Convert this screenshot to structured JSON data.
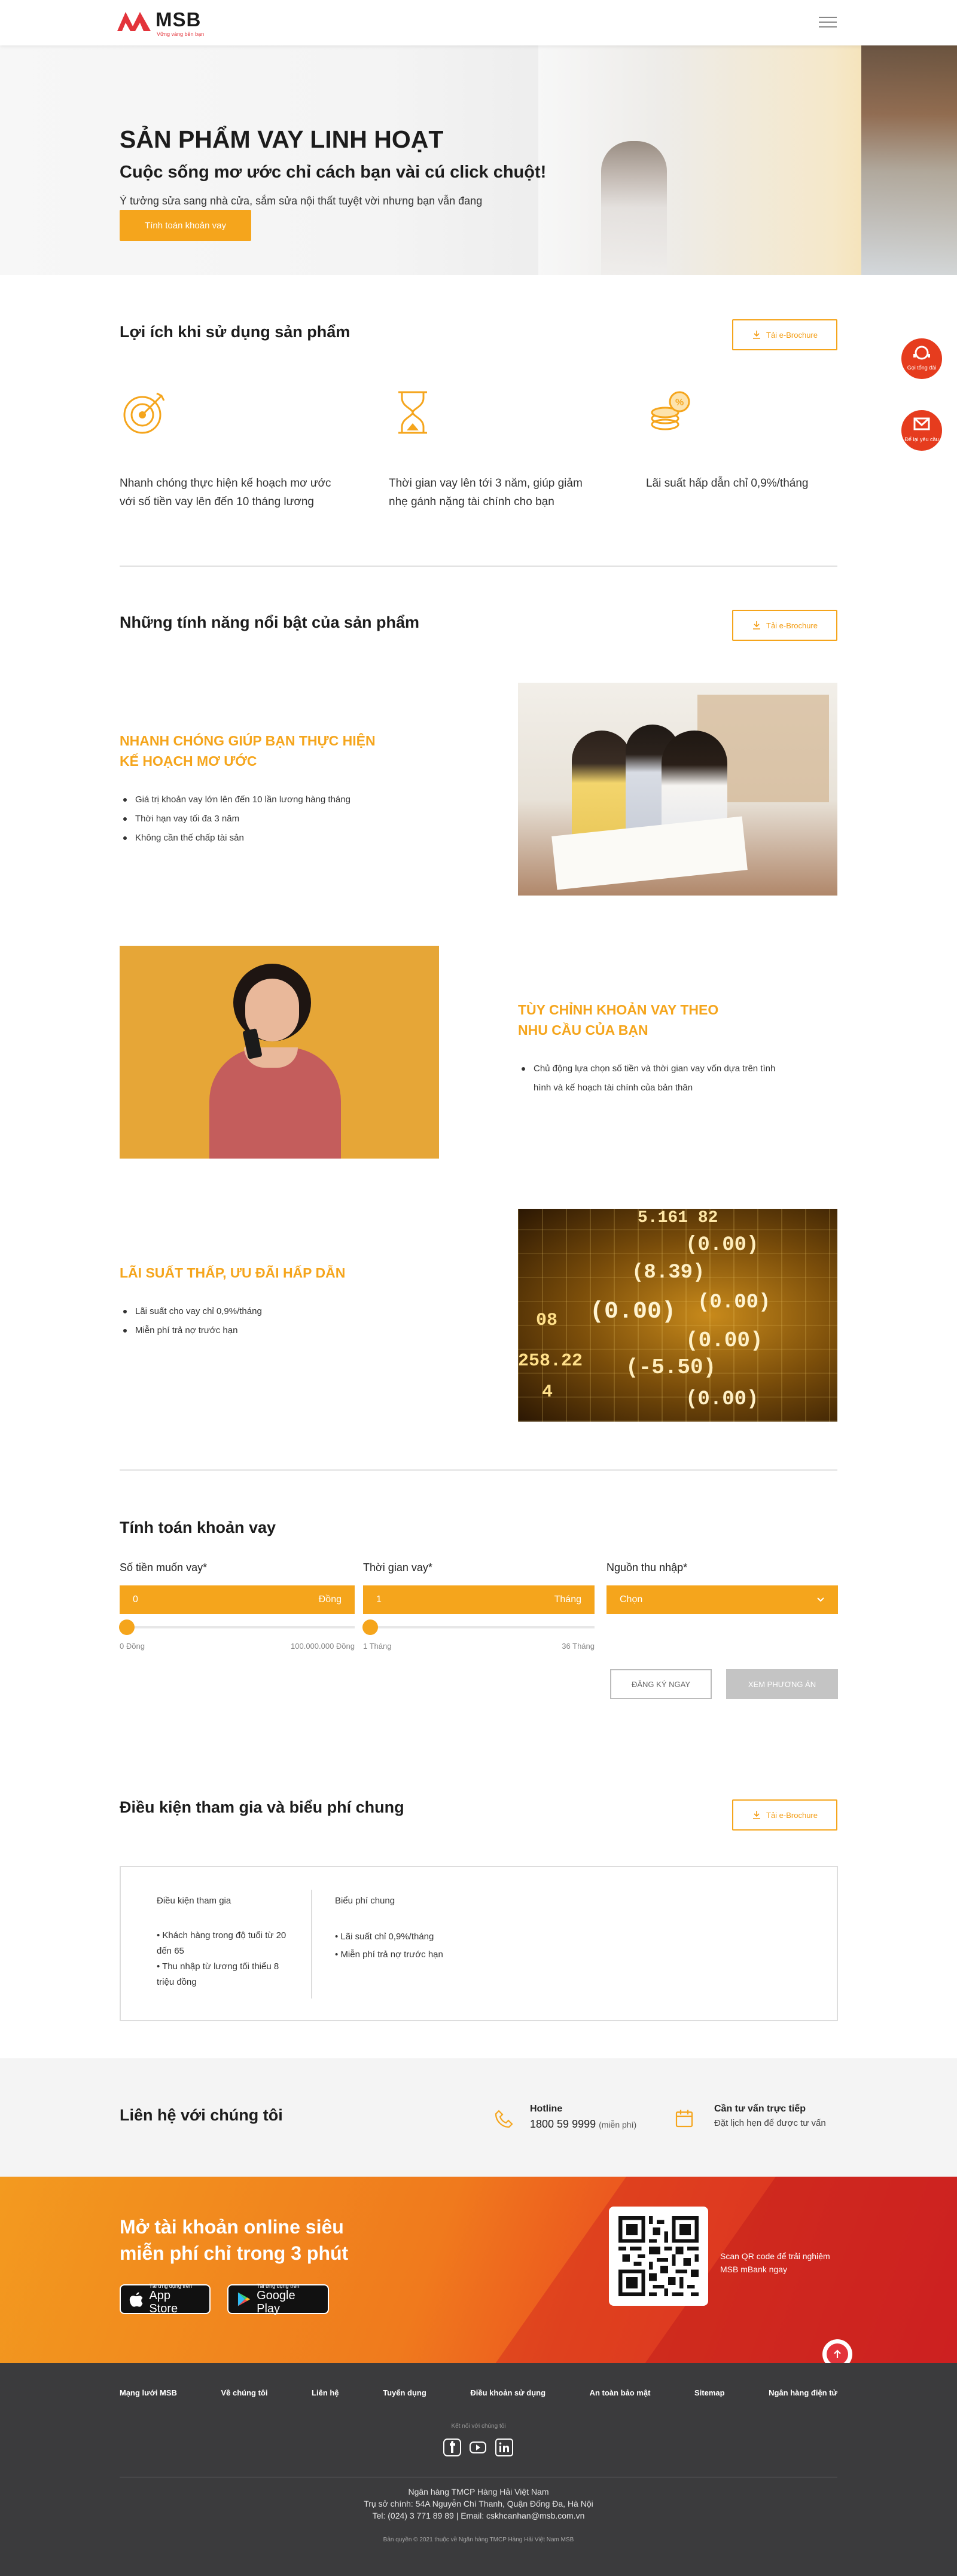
{
  "header": {
    "brand": "MSB",
    "tagline": "Vững vàng bên bạn"
  },
  "hero": {
    "title": "SẢN PHẨM VAY LINH HOẠT",
    "subtitle": "Cuộc sống mơ ước chỉ cách bạn vài cú click chuột!",
    "desc": "Ý tưởng sửa sang nhà cửa, sắm sửa nội thất tuyệt vời nhưng bạn vẫn đang đau đầu tìm vốn?",
    "cta": "Tính toán khoản vay"
  },
  "benefits": {
    "title": "Lợi ích khi sử dụng sản phẩm",
    "brochure": "Tải e-Brochure",
    "items": [
      {
        "icon": "target-icon",
        "text": "Nhanh chóng thực hiện kế hoạch mơ ước với số tiền vay lên đến 10 tháng lương"
      },
      {
        "icon": "hourglass-icon",
        "text": "Thời gian vay lên tới 3 năm, giúp giảm nhẹ gánh nặng tài chính cho bạn"
      },
      {
        "icon": "coins-percent-icon",
        "text": "Lãi suất hấp dẫn chỉ 0,9%/tháng"
      }
    ]
  },
  "features": {
    "title": "Những tính năng nổi bật của sản phẩm",
    "brochure": "Tải e-Brochure",
    "items": [
      {
        "heading1": "NHANH CHÓNG GIÚP BẠN THỰC HIỆN",
        "heading2": "KẾ HOẠCH MƠ ƯỚC",
        "bullets": [
          "Giá trị khoản vay lớn lên đến 10 lần lương hàng tháng",
          "Thời hạn vay tối đa 3 năm",
          "Không cần thế chấp tài sản"
        ]
      },
      {
        "heading1": "TÙY CHỈNH KHOẢN VAY THEO",
        "heading2": "NHU CẦU CỦA BẠN",
        "bullets": [
          "Chủ động lựa chọn số tiền và thời gian vay vốn dựa trên tình hình và kế hoạch tài chính của bản thân"
        ]
      },
      {
        "heading1": "LÃI SUẤT THẤP, ƯU ĐÃI HẤP DẪN",
        "bullets": [
          "Lãi suất cho vay chỉ 0,9%/tháng",
          "Miễn phí trả nợ trước hạn"
        ]
      }
    ],
    "numbers": [
      "5.161 82",
      "(0.00)",
      "(8.39)",
      "(0.00)",
      "08",
      "(0.00)",
      "(-5.50)",
      "(0.00)",
      "(0.00)",
      "258.22",
      "4"
    ]
  },
  "calculator": {
    "title": "Tính toán khoản vay",
    "amount": {
      "label": "Số tiền muốn vay*",
      "value": "0",
      "unit": "Đồng",
      "min": "0 Đồng",
      "max": "100.000.000 Đồng"
    },
    "term": {
      "label": "Thời gian vay*",
      "value": "1",
      "unit": "Tháng",
      "min": "1 Tháng",
      "max": "36 Tháng"
    },
    "income": {
      "label": "Nguồn thu nhập*",
      "placeholder": "Chọn"
    },
    "register": "ĐĂNG KÝ NGAY",
    "view": "XEM PHƯƠNG ÁN"
  },
  "conditions": {
    "title": "Điều kiện tham gia và biểu phí chung",
    "brochure": "Tải e-Brochure",
    "left": {
      "title": "Điều kiện tham gia",
      "items": [
        "• Khách hàng trong độ tuổi từ 20 đến 65",
        "• Thu nhập từ lương tối thiểu 8 triệu đồng"
      ]
    },
    "right": {
      "title": "Biểu phí chung",
      "items": [
        "• Lãi suất chỉ 0,9%/tháng",
        "• Miễn phí trả nợ trước hạn"
      ]
    }
  },
  "contact": {
    "title": "Liên hệ với chúng tôi",
    "hotline_label": "Hotline",
    "hotline": "1800 59 9999",
    "hotline_note": "(miễn phí)",
    "consult_label": "Cần tư vấn trực tiếp",
    "consult_text": "Đặt lịch hẹn để được tư vấn"
  },
  "promo": {
    "line1": "Mở tài khoản online siêu",
    "line2": "miễn phí chỉ trong 3 phút",
    "appstore_small": "Tải ứng dụng trên",
    "appstore": "App Store",
    "gplay_small": "Tải ứng dụng trên",
    "gplay": "Google Play",
    "qr_text": "Scan QR code để trải nghiệm MSB mBank ngay"
  },
  "floating": {
    "call": "Gọi tổng đài",
    "request": "Để lại yêu cầu"
  },
  "footer": {
    "nav": [
      "Mạng lưới MSB",
      "Về chúng tôi",
      "Liên hệ",
      "Tuyển dụng",
      "Điều khoản sử dụng",
      "An toàn bảo mật",
      "Sitemap",
      "Ngân hàng điện tử"
    ],
    "connect": "Kết nối với chúng tôi",
    "bank": "Ngân hàng TMCP Hàng Hải Việt Nam",
    "address": "Trụ sở chính: 54A Nguyễn Chí Thanh, Quận Đống Đa, Hà Nội",
    "phone": "Tel: (024) 3 771 89 89  |  Email: cskhcanhan@msb.com.vn",
    "copyright": "Bản quyền © 2021 thuộc về Ngân hàng TMCP Hàng Hải Việt Nam MSB"
  },
  "colors": {
    "accent": "#f5a51c",
    "brand_red": "#e3343b",
    "footer_bg": "#3b3b3d"
  }
}
